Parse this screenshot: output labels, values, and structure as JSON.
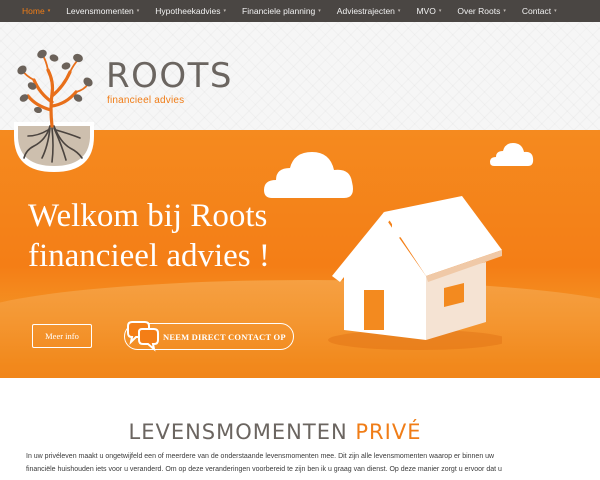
{
  "nav": {
    "items": [
      {
        "label": "Home",
        "active": true,
        "dropdown": true
      },
      {
        "label": "Levensmomenten",
        "active": false,
        "dropdown": true
      },
      {
        "label": "Hypotheekadvies",
        "active": false,
        "dropdown": true
      },
      {
        "label": "Financiele planning",
        "active": false,
        "dropdown": true
      },
      {
        "label": "Adviestrajecten",
        "active": false,
        "dropdown": true
      },
      {
        "label": "MVO",
        "active": false,
        "dropdown": true
      },
      {
        "label": "Over Roots",
        "active": false,
        "dropdown": true
      },
      {
        "label": "Contact",
        "active": false,
        "dropdown": true
      }
    ],
    "caret": "▾"
  },
  "logo": {
    "name": "ROOTS",
    "tagline": "financieel advies"
  },
  "hero": {
    "title_line1": "Welkom bij Roots",
    "title_line2": "financieel advies !",
    "more_button": "Meer info",
    "contact_button": "NEEM DIRECT CONTACT OP"
  },
  "section": {
    "title_main": "LEVENSMOMENTEN",
    "title_highlight": "PRIVÉ",
    "line1": "In uw privéleven maakt u ongetwijfeld een of meerdere van de onderstaande levensmomenten mee. Dit zijn alle levensmomenten waarop er binnen uw",
    "line2": "financiële huishouden iets voor u veranderd. Om op deze veranderingen voorbereid te zijn ben ik u graag van dienst. Op deze manier zorgt u ervoor dat u"
  },
  "colors": {
    "accent": "#f07d17",
    "nav_bg": "#4a4643",
    "hero_orange": "#f47e16",
    "text_gray": "#6b6560"
  }
}
